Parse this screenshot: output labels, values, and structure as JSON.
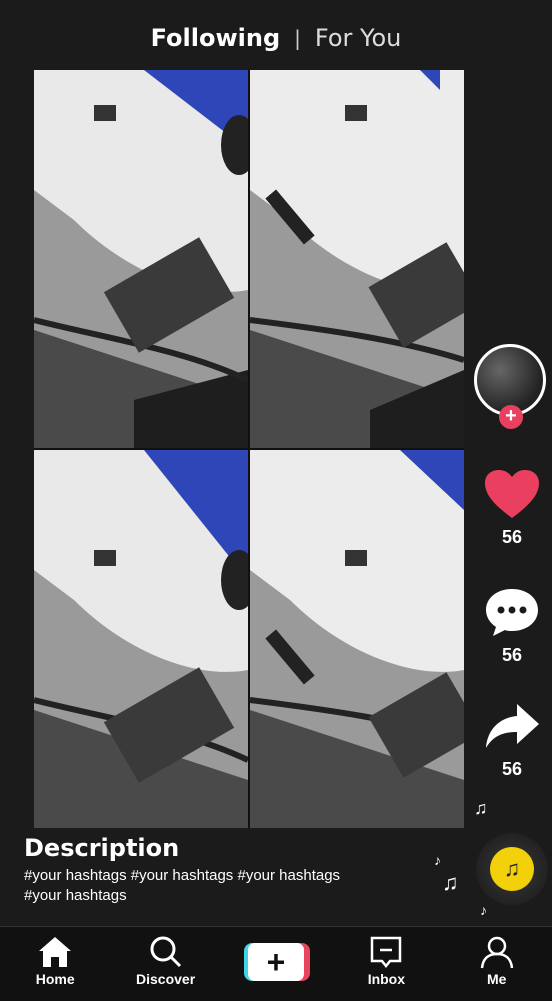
{
  "header": {
    "tab_following": "Following",
    "tab_separator": "|",
    "tab_foryou": "For You"
  },
  "actions": {
    "like_count": "56",
    "comment_count": "56",
    "share_count": "56"
  },
  "description": {
    "title": "Description",
    "hashtags": "#your hashtags #your hashtags #your hashtags #your hashtags"
  },
  "nav": [
    {
      "label": "Home",
      "icon": "home-icon"
    },
    {
      "label": "Discover",
      "icon": "search-icon"
    },
    {
      "label": "",
      "icon": "plus-icon"
    },
    {
      "label": "Inbox",
      "icon": "inbox-icon"
    },
    {
      "label": "Me",
      "icon": "profile-icon"
    }
  ],
  "colors": {
    "like": "#ea3f5f",
    "music": "#f2d10b",
    "accent_cyan": "#44d3e6",
    "accent_red": "#e9445d"
  }
}
